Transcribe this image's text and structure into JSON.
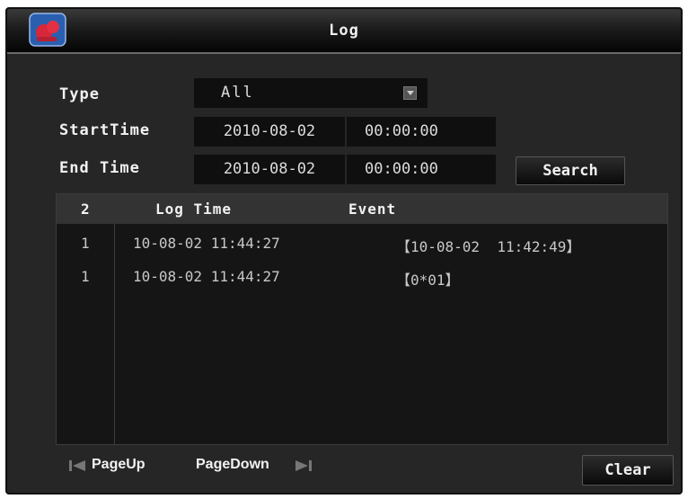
{
  "window": {
    "title": "Log"
  },
  "form": {
    "type_label": "Type",
    "type_value": "All",
    "start_label": "StartTime",
    "start_date": "2010-08-02",
    "start_time": "00:00:00",
    "end_label": "End Time",
    "end_date": "2010-08-02",
    "end_time": "00:00:00",
    "search_label": "Search"
  },
  "table": {
    "headers": {
      "count": "2",
      "log_time": "Log Time",
      "event": "Event"
    },
    "rows": [
      {
        "index": "1",
        "log_time": "10-08-02 11:44:27",
        "event": "【10-08-02  11:42:49】"
      },
      {
        "index": "1",
        "log_time": "10-08-02 11:44:27",
        "event": "【0*01】"
      }
    ]
  },
  "footer": {
    "page_up": "PageUp",
    "page_down": "PageDown",
    "clear": "Clear"
  },
  "icons": {
    "logo": "app-logo-icon",
    "dropdown": "dropdown-arrow-icon",
    "page_up": "page-up-arrow-icon",
    "page_down": "page-down-arrow-icon"
  }
}
